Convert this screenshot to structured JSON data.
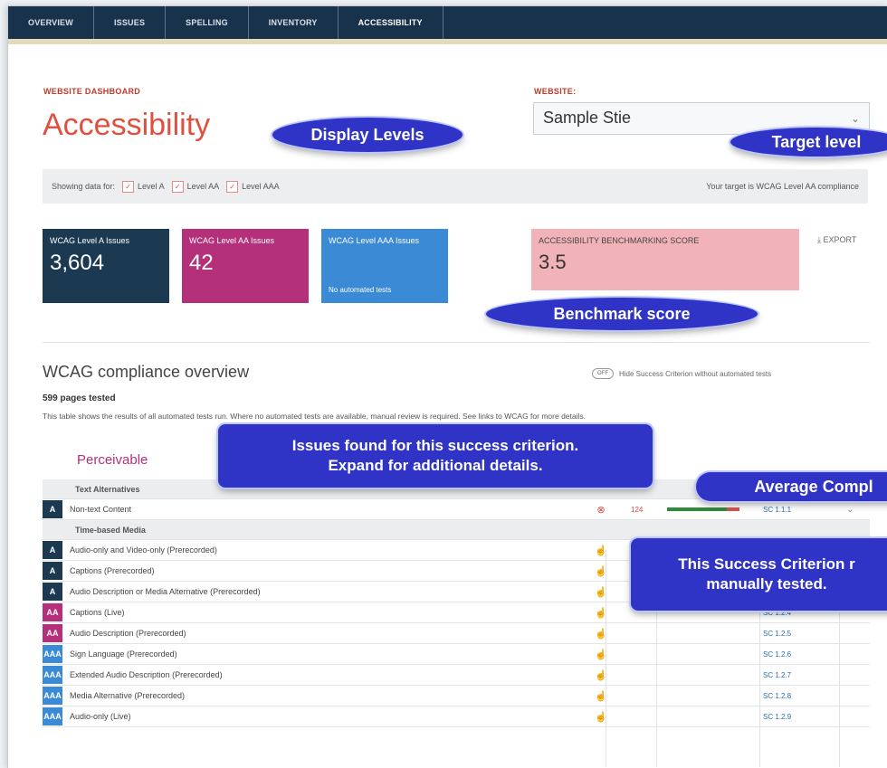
{
  "nav": {
    "tabs": [
      "OVERVIEW",
      "ISSUES",
      "SPELLING",
      "INVENTORY",
      "ACCESSIBILITY"
    ],
    "active": "ACCESSIBILITY"
  },
  "header": {
    "subtitle": "WEBSITE DASHBOARD",
    "title": "Accessibility",
    "website_label": "WEBSITE:",
    "website_value": "Sample Stie"
  },
  "filter": {
    "showing_label": "Showing data for:",
    "levels": [
      "Level A",
      "Level AA",
      "Level AAA"
    ],
    "target_text": "Your target is WCAG Level AA compliance"
  },
  "cards": {
    "level_a": {
      "title": "WCAG Level A Issues",
      "value": "3,604"
    },
    "level_aa": {
      "title": "WCAG Level AA Issues",
      "value": "42"
    },
    "level_aaa": {
      "title": "WCAG Level AAA Issues",
      "sub": "No automated tests"
    },
    "benchmark": {
      "title": "ACCESSIBILITY BENCHMARKING SCORE",
      "value": "3.5"
    },
    "export_label": "⤓ EXPORT"
  },
  "overview": {
    "title": "WCAG compliance overview",
    "toggle_state": "OFF",
    "toggle_label": "Hide Success Criterion without automated tests",
    "pages_tested": "599 pages tested",
    "description": "This table shows the results of all automated tests run. Where no automated tests are available, manual review is required. See links to WCAG for more details.",
    "principle": "Perceivable"
  },
  "table": {
    "groups": [
      {
        "name": "Text Alternatives",
        "rows": [
          {
            "level": "A",
            "name": "Non-text Content",
            "status": "⊗",
            "status_type": "error",
            "count": "124",
            "compliance": 0.82,
            "sc": "SC 1.1.1",
            "chevron": "⌄"
          }
        ]
      },
      {
        "name": "Time-based Media",
        "rows": [
          {
            "level": "A",
            "name": "Audio-only and Video-only (Prerecorded)",
            "status": "☝",
            "status_type": "manual",
            "sc": ""
          },
          {
            "level": "A",
            "name": "Captions (Prerecorded)",
            "status": "☝",
            "status_type": "manual",
            "sc": ""
          },
          {
            "level": "A",
            "name": "Audio Description or Media Alternative (Prerecorded)",
            "status": "☝",
            "status_type": "manual",
            "sc": ""
          },
          {
            "level": "AA",
            "name": "Captions (Live)",
            "status": "☝",
            "status_type": "manual",
            "sc": "SC 1.2.4"
          },
          {
            "level": "AA",
            "name": "Audio Description (Prerecorded)",
            "status": "☝",
            "status_type": "manual",
            "sc": "SC 1.2.5"
          },
          {
            "level": "AAA",
            "name": "Sign Language (Prerecorded)",
            "status": "☝",
            "status_type": "manual",
            "sc": "SC 1.2.6"
          },
          {
            "level": "AAA",
            "name": "Extended Audio Description (Prerecorded)",
            "status": "☝",
            "status_type": "manual",
            "sc": "SC 1.2.7"
          },
          {
            "level": "AAA",
            "name": "Media Alternative (Prerecorded)",
            "status": "☝",
            "status_type": "manual",
            "sc": "SC 1.2.8"
          },
          {
            "level": "AAA",
            "name": "Audio-only (Live)",
            "status": "☝",
            "status_type": "manual",
            "sc": "SC 1.2.9"
          }
        ]
      }
    ]
  },
  "callouts": {
    "display_levels": "Display Levels",
    "target_level": "Target level",
    "benchmark_score": "Benchmark score",
    "issues_found_line1": "Issues found for this success criterion.",
    "issues_found_line2": "Expand for additional details.",
    "average_compliance": "Average Compl",
    "manual_line1": "This Success Criterion r",
    "manual_line2": "manually tested."
  },
  "colors": {
    "nav": "#17324a",
    "title": "#e0503e",
    "level_a": "#1b3a52",
    "level_aa": "#b5307a",
    "level_aaa": "#3b8ad6",
    "benchmark": "#f2b3b8",
    "callout": "#2f33c6"
  }
}
